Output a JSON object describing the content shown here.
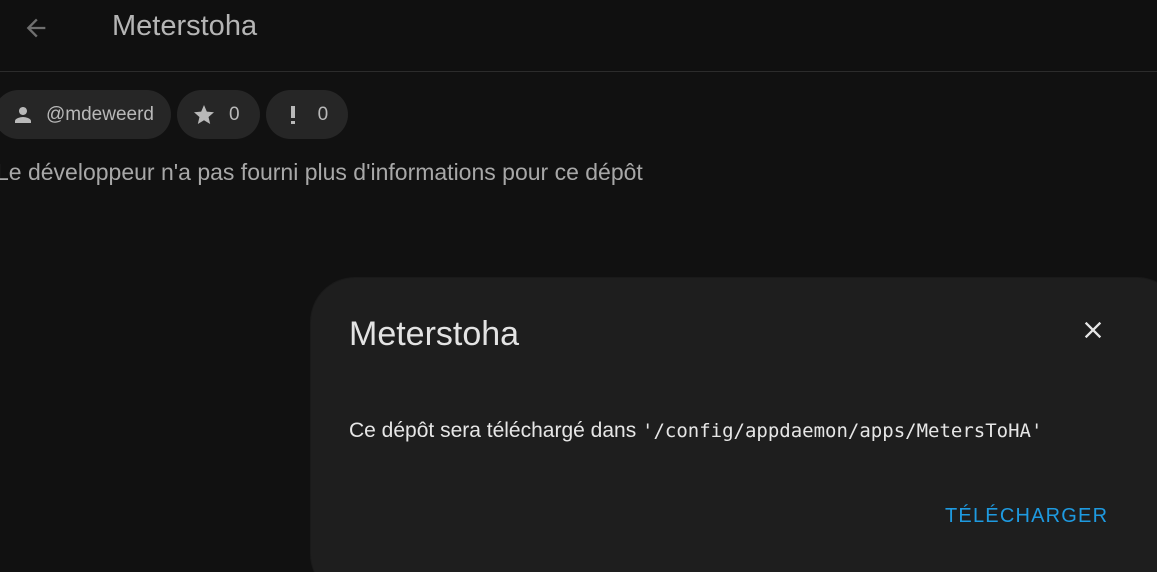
{
  "header": {
    "title": "Meterstoha",
    "back_icon": "arrow-left-icon"
  },
  "chips": {
    "author": {
      "icon": "account-icon",
      "label": "@mdeweerd"
    },
    "stars": {
      "icon": "star-icon",
      "count": "0"
    },
    "issues": {
      "icon": "exclamation-icon",
      "count": "0"
    }
  },
  "description": "Le développeur n'a pas fourni plus d'informations pour ce dépôt",
  "dialog": {
    "title": "Meterstoha",
    "close_icon": "close-icon",
    "body_text": "Ce dépôt sera téléchargé dans ",
    "body_path": "'/config/appdaemon/apps/MetersToHA'",
    "download_label": "TÉLÉCHARGER"
  },
  "colors": {
    "background": "#111111",
    "dialog_background": "#1e1e1e",
    "chip_background": "#262626",
    "accent": "#1e9ae0"
  }
}
